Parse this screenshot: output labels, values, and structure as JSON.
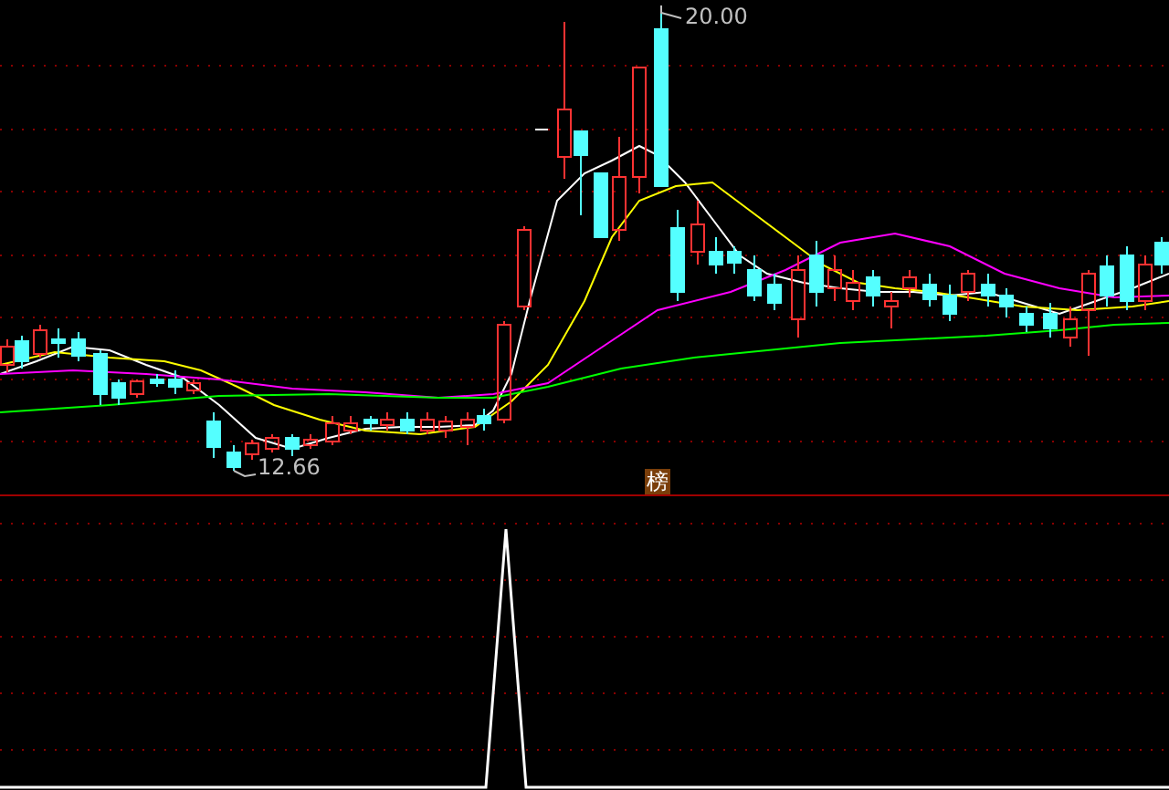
{
  "price_panel": {
    "high_label": "20.00",
    "low_label": "12.66",
    "badge": "榜"
  }
}
